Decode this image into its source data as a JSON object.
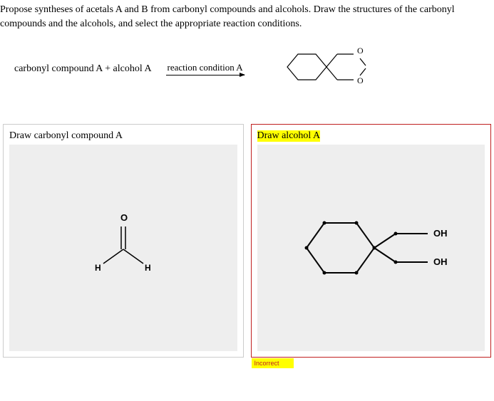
{
  "question": "Propose syntheses of acetals A and B from carbonyl compounds and alcohols. Draw the structures of the carbonyl compounds and the alcohols, and select the appropriate reaction conditions.",
  "reaction": {
    "reactants": "carbonyl compound A + alcohol A",
    "condition": "reaction condition A"
  },
  "panelA": {
    "title": "Draw carbonyl compound A",
    "atom_o": "O",
    "atom_h1": "H",
    "atom_h2": "H"
  },
  "panelB": {
    "title": "Draw alcohol A",
    "oh1": "OH",
    "oh2": "OH",
    "feedback": "Incorrect"
  },
  "product": {
    "o1": "O",
    "o2": "O"
  }
}
